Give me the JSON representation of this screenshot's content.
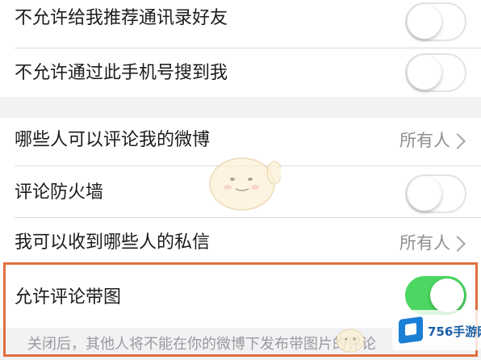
{
  "settings": {
    "rows": [
      {
        "label": "不允许给我推荐通讯录好友",
        "toggle": "off"
      },
      {
        "label": "不允许通过此手机号搜到我",
        "toggle": "off"
      },
      {
        "label": "哪些人可以评论我的微博",
        "value": "所有人"
      },
      {
        "label": "评论防火墙",
        "toggle": "off"
      },
      {
        "label": "我可以收到哪些人的私信",
        "value": "所有人"
      },
      {
        "label": "允许评论带图",
        "toggle": "on"
      }
    ],
    "footer": "关闭后，其他人将不能在你的微博下发布带图片的评论"
  },
  "watermark": {
    "text": "756手游网"
  },
  "colors": {
    "toggle_on": "#4bd762",
    "highlight_border": "#e0703f",
    "accent_value": "#8e8e93"
  }
}
